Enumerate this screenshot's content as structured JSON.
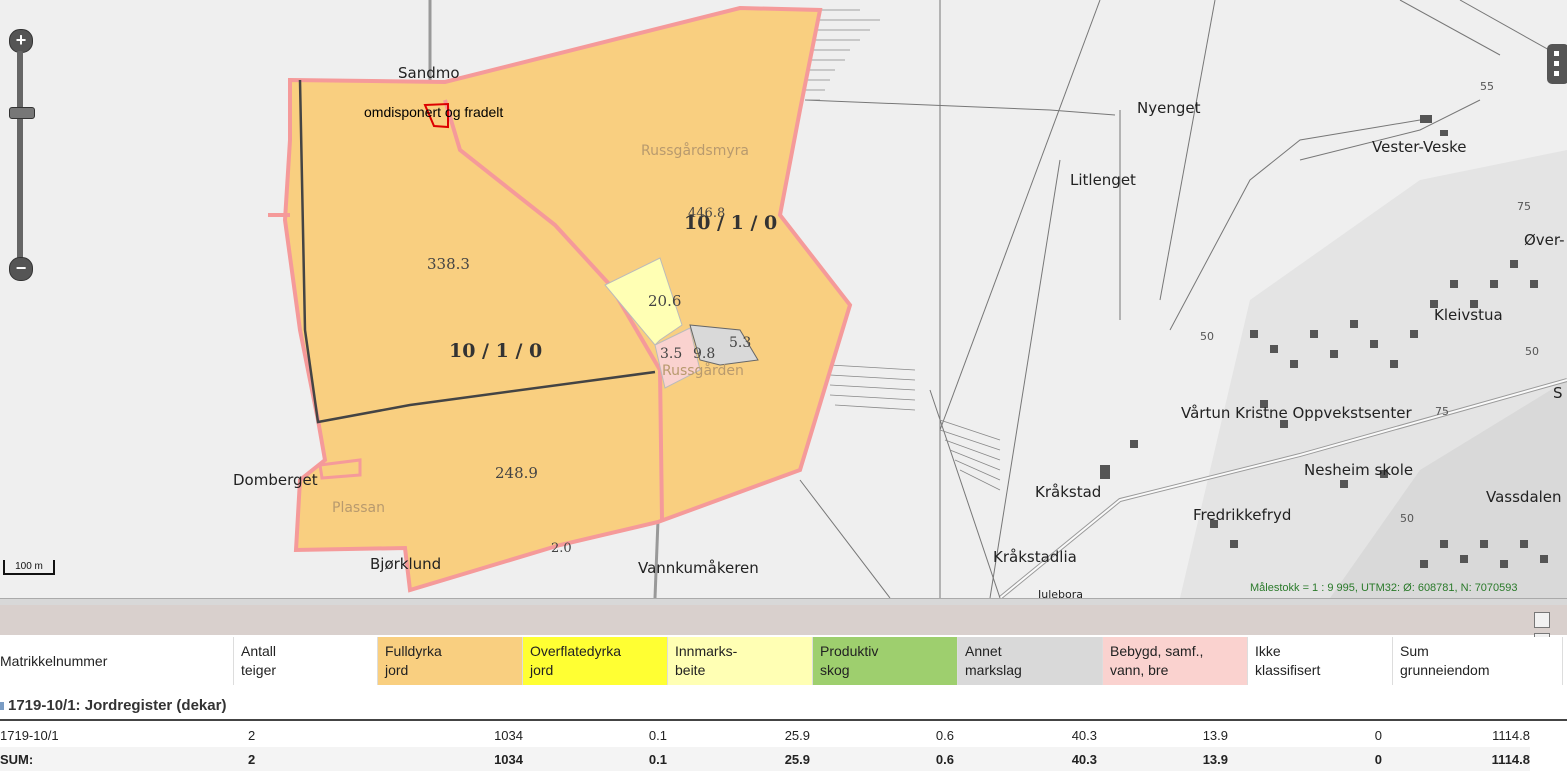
{
  "map": {
    "place_labels": [
      "Sandmo",
      "Nyenget",
      "Vester-Veske",
      "Litlenget",
      "Øver-",
      "Kleivstua",
      "Vårtun Kristne Oppvekstsenter",
      "S",
      "Nesheim skole",
      "Kråkstad",
      "Vassdalen",
      "Fredrikkefryd",
      "Kråkstadlia",
      "Domberget",
      "Bjørklund",
      "Vannkumåkeren",
      "Julebora"
    ],
    "terrain_labels": [
      "Russgårdsmyra",
      "Plassan",
      "Russgården"
    ],
    "annotation": "omdisponert og fradelt",
    "parcel_labels": [
      "10 / 1 / 0",
      "10 / 1 / 0"
    ],
    "area_labels": [
      "338.3",
      "248.9",
      "446.8",
      "20.6",
      "9.8",
      "5.3",
      "3.5",
      "2.0"
    ],
    "contour_labels": [
      "50",
      "50",
      "75",
      "75",
      "50",
      "55"
    ],
    "scale_label": "100 m",
    "status_text": "Målestokk = 1 : 9 995, UTM32: Ø: 608781, N: 7070593",
    "zoom_in": "+",
    "zoom_out": "−",
    "colors": {
      "fulldyrka": "#f9cf80",
      "overflatedyrka": "#ffff33",
      "innmarksbeite": "#ffffb4",
      "produktiv_skog": "#9ecf6e",
      "annet_markslag": "#d9d9d9",
      "bebygd": "#fad2cf",
      "ikke_klassifisert": "#ffffff",
      "parcel_border": "#f59a9a",
      "map_bg": "#efefef"
    }
  },
  "table": {
    "headers": [
      {
        "l1": "Matrikkelnummer",
        "l2": ""
      },
      {
        "l1": "Antall",
        "l2": "teiger"
      },
      {
        "l1": "Fulldyrka",
        "l2": "jord"
      },
      {
        "l1": "Overflatedyrka",
        "l2": "jord"
      },
      {
        "l1": "Innmarks-",
        "l2": "beite"
      },
      {
        "l1": "Produktiv",
        "l2": "skog"
      },
      {
        "l1": "Annet",
        "l2": "markslag"
      },
      {
        "l1": "Bebygd, samf.,",
        "l2": "vann, bre"
      },
      {
        "l1": "Ikke",
        "l2": "klassifisert"
      },
      {
        "l1": "Sum",
        "l2": "grunneiendom"
      }
    ],
    "title": "1719-10/1: Jordregister (dekar)",
    "rows": [
      [
        "1719-10/1",
        "2",
        "1034",
        "0.1",
        "25.9",
        "0.6",
        "40.3",
        "13.9",
        "0",
        "1114.8"
      ],
      [
        "SUM:",
        "2",
        "1034",
        "0.1",
        "25.9",
        "0.6",
        "40.3",
        "13.9",
        "0",
        "1114.8"
      ]
    ]
  }
}
